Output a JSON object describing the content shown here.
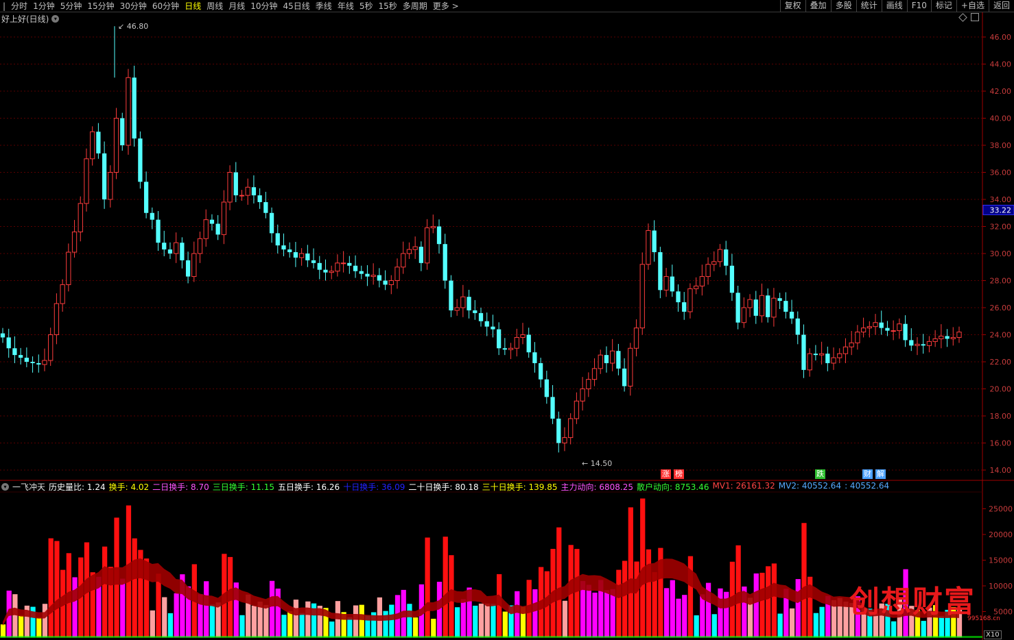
{
  "toolbar": {
    "periods": [
      "分时",
      "1分钟",
      "5分钟",
      "15分钟",
      "30分钟",
      "60分钟",
      "日线",
      "周线",
      "月线",
      "10分钟",
      "45日线",
      "季线",
      "年线",
      "5秒",
      "15秒",
      "多周期",
      "更多 >"
    ],
    "active": "日线",
    "right_buttons": [
      "复权",
      "叠加",
      "多股",
      "统计",
      "画线",
      "F10",
      "标记",
      "+自选",
      "返回"
    ]
  },
  "stock": {
    "title": "好上好(日线)"
  },
  "price_axis": {
    "labels": [
      "46.00",
      "44.00",
      "42.00",
      "40.00",
      "38.00",
      "36.00",
      "34.00",
      "32.00",
      "30.00",
      "28.00",
      "26.00",
      "24.00",
      "22.00",
      "20.00",
      "18.00",
      "16.00",
      "14.00"
    ],
    "current": "33.22"
  },
  "annotations": {
    "high": "46.80",
    "low": "14.50"
  },
  "markers": [
    "涨",
    "榜",
    "跌",
    "财",
    "解"
  ],
  "indicator": {
    "name": "一飞冲天",
    "items": [
      {
        "label": "历史量比:",
        "value": "1.24",
        "color": "#ffffff"
      },
      {
        "label": "换手:",
        "value": "4.02",
        "color": "#ffff00"
      },
      {
        "label": "二日换手:",
        "value": "8.70",
        "color": "#ff55ff"
      },
      {
        "label": "三日换手:",
        "value": "11.15",
        "color": "#33ff33"
      },
      {
        "label": "五日换手:",
        "value": "16.26",
        "color": "#ffffff"
      },
      {
        "label": "十日换手:",
        "value": "36.09",
        "color": "#2222ff"
      },
      {
        "label": "二十日换手:",
        "value": "80.18",
        "color": "#ffffff"
      },
      {
        "label": "三十日换手:",
        "value": "139.85",
        "color": "#ffff00"
      },
      {
        "label": "主力动向:",
        "value": "6808.25",
        "color": "#ff55ff"
      },
      {
        "label": "散户动向:",
        "value": "8753.46",
        "color": "#33ff33"
      },
      {
        "label": "MV1:",
        "value": "26161.32",
        "color": "#ff4444"
      },
      {
        "label": "MV2:",
        "value": "40552.64",
        "color": "#55aaff"
      },
      {
        "label": ":",
        "value": "40552.64",
        "color": "#55aaff"
      }
    ],
    "axis_labels": [
      "25000",
      "20000",
      "15000",
      "10000",
      "5000"
    ]
  },
  "brand": {
    "name": "创想财富",
    "url": "995168.cn"
  },
  "zoom_label": "X10"
}
